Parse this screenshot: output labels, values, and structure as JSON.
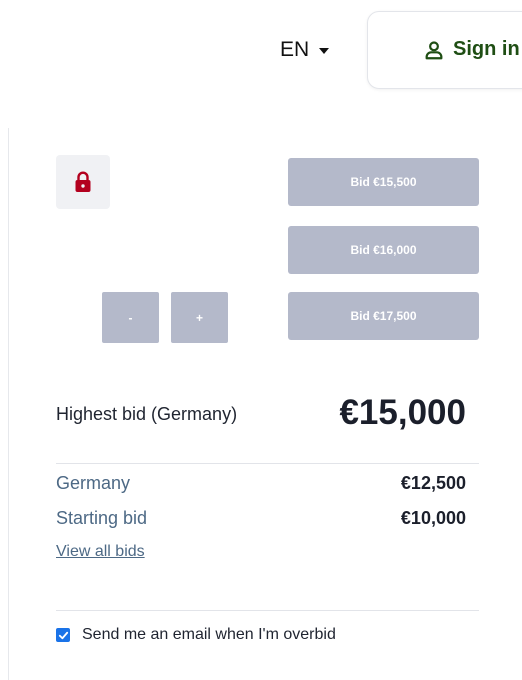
{
  "header": {
    "language": "EN",
    "sign_in_label": "Sign in"
  },
  "bidding": {
    "bid_buttons": [
      "Bid €15,500",
      "Bid €16,000",
      "Bid €17,500"
    ],
    "stepper": {
      "minus": "-",
      "plus": "+"
    }
  },
  "summary": {
    "highest_label": "Highest bid (Germany)",
    "highest_value": "€15,000",
    "rows": [
      {
        "label": "Germany",
        "value": "€12,500"
      },
      {
        "label": "Starting bid",
        "value": "€10,000"
      }
    ],
    "view_all": "View all bids"
  },
  "notification": {
    "email_label": "Send me an email when I'm overbid",
    "checked": true
  },
  "colors": {
    "bid_button": "#b4b9ca",
    "lock_icon": "#b3001e",
    "sign_in": "#1f4e14",
    "link": "#4d6985",
    "checkbox": "#1a73e8"
  }
}
